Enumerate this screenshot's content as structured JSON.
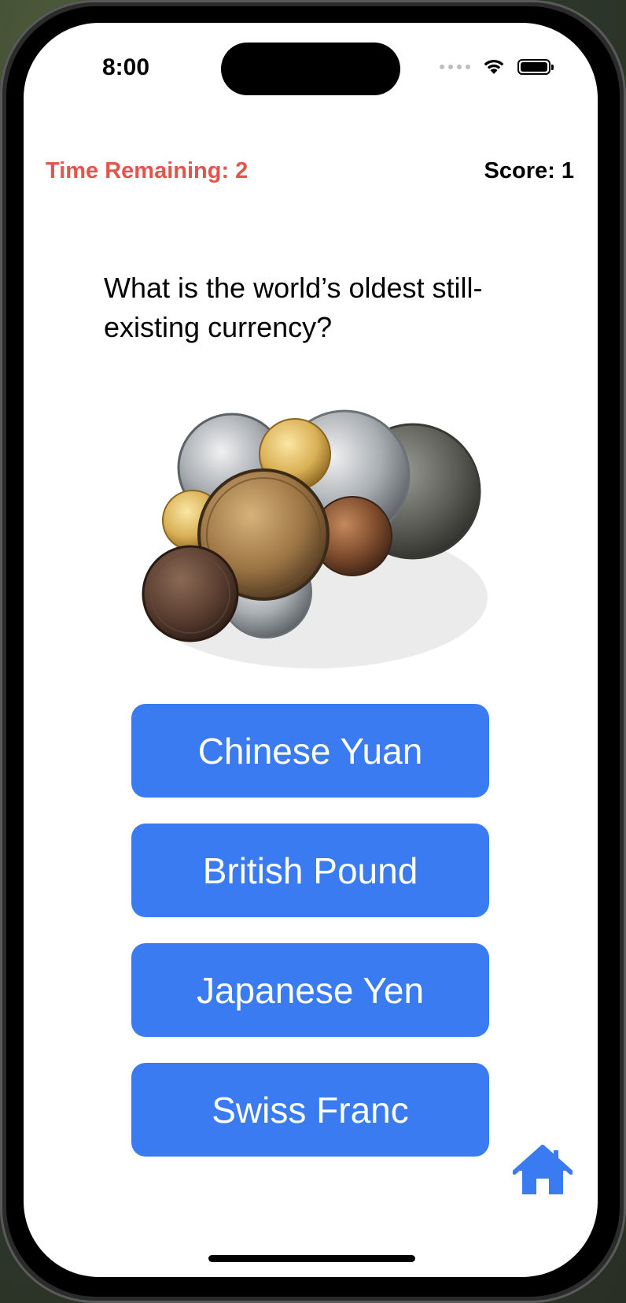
{
  "status_bar": {
    "time": "8:00"
  },
  "quiz": {
    "timer_text": "Time Remaining: 2",
    "score_text": "Score: 1",
    "question": "What is the world’s oldest still-existing currency?",
    "answers": [
      {
        "label": "Chinese Yuan"
      },
      {
        "label": "British Pound"
      },
      {
        "label": "Japanese Yen"
      },
      {
        "label": "Swiss Franc"
      }
    ]
  },
  "colors": {
    "accent": "#3a7bf2",
    "timer": "#e5534b",
    "background": "#ffffff"
  },
  "icons": {
    "home": "home-icon",
    "wifi": "wifi-icon",
    "battery": "battery-icon"
  }
}
